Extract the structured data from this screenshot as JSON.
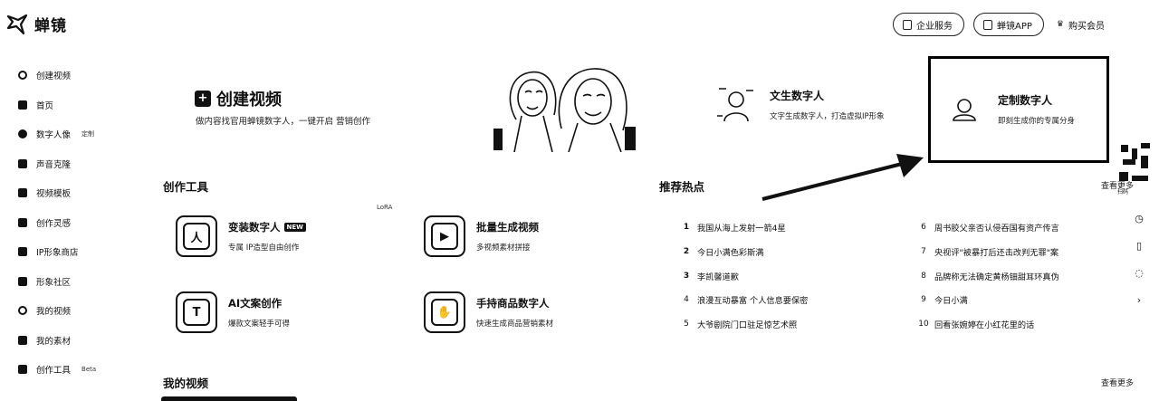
{
  "brand": {
    "name": "蝉镜"
  },
  "topbar": {
    "enterprise": "企业服务",
    "app": "蝉镜APP",
    "vip": "购买会员"
  },
  "sidebar": {
    "items": [
      {
        "label": "创建视频",
        "icon": "plus-circle-icon"
      },
      {
        "label": "首页",
        "icon": "home-icon"
      },
      {
        "label": "数字人像",
        "icon": "person-icon",
        "tag": "定制"
      },
      {
        "label": "声音克隆",
        "icon": "mic-icon"
      },
      {
        "label": "视频模板",
        "icon": "template-icon"
      },
      {
        "label": "创作灵感",
        "icon": "bulb-icon"
      },
      {
        "label": "IP形象商店",
        "icon": "shop-icon"
      },
      {
        "label": "形象社区",
        "icon": "community-icon"
      },
      {
        "label": "我的视频",
        "icon": "video-icon"
      },
      {
        "label": "我的素材",
        "icon": "folder-icon"
      },
      {
        "label": "创作工具",
        "icon": "tools-icon",
        "tag": "Beta"
      }
    ]
  },
  "hero": {
    "title": "创建视频",
    "subtitle": "做内容找官用蝉镜数字人，一键开启 营销创作"
  },
  "features": [
    {
      "title": "文生数字人",
      "desc": "文字生成数字人，打造虚拟IP形象"
    },
    {
      "title": "定制数字人",
      "desc": "即刻生成你的专属分身"
    }
  ],
  "tools_section": {
    "title": "创作工具",
    "lora": "LoRA"
  },
  "tools": [
    {
      "title": "变装数字人",
      "badge": "NEW",
      "desc": "专属 IP造型自由创作",
      "glyph": "人"
    },
    {
      "title": "批量生成视频",
      "desc": "多视频素材拼接",
      "glyph": "▶"
    },
    {
      "title": "AI文案创作",
      "desc": "爆款文案轻手可得",
      "glyph": "T"
    },
    {
      "title": "手持商品数字人",
      "desc": "快速生成商品营销素材",
      "glyph": "✋"
    }
  ],
  "hot_section": {
    "title": "推荐热点",
    "more": "查看更多"
  },
  "hot_left": [
    {
      "rank": "1",
      "text": "我国从海上发射一箭4星"
    },
    {
      "rank": "2",
      "text": "今日小满色彩斯满"
    },
    {
      "rank": "3",
      "text": "李凯馨道歉"
    },
    {
      "rank": "4",
      "text": "浪漫互动暴富 个人信息要保密"
    },
    {
      "rank": "5",
      "text": "大爷剧院门口驻足惊艺术照"
    }
  ],
  "hot_right": [
    {
      "rank": "6",
      "text": "周书胶父亲否认侵吞国有资产传言"
    },
    {
      "rank": "7",
      "text": "央视评\"被暴打后还击改判无罪\"案"
    },
    {
      "rank": "8",
      "text": "品牌称无法确定黄杨钿甜耳环真伪"
    },
    {
      "rank": "9",
      "text": "今日小满"
    },
    {
      "rank": "10",
      "text": "回看张婉婷在小红花里的话"
    }
  ],
  "videos_section": {
    "title": "我的视频",
    "more": "查看更多"
  },
  "colors": {
    "ink": "#111111",
    "background": "#ffffff"
  }
}
